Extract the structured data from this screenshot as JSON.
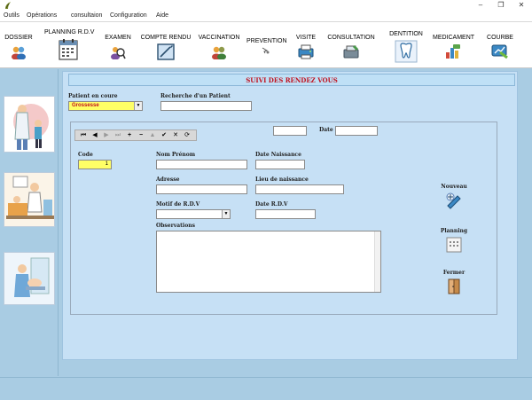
{
  "menubar": {
    "items": [
      "Outils",
      "Opérations",
      "consultaion",
      "Configuration",
      "Aide"
    ]
  },
  "window_controls": {
    "minimize": "‒",
    "restore": "❐",
    "close": "✕"
  },
  "toolbar": {
    "items": [
      {
        "label": "DOSSIER",
        "icon": "patients-icon"
      },
      {
        "label": "PLANNING R.D.V",
        "icon": "calendar-icon"
      },
      {
        "label": "EXAMEN",
        "icon": "examination-icon"
      },
      {
        "label": "COMPTE RENDU",
        "icon": "report-icon"
      },
      {
        "label": "VACCINATION",
        "icon": "vaccination-icon"
      },
      {
        "label": "PREVENTION",
        "icon": "prevention-icon"
      },
      {
        "label": "VISITE",
        "icon": "visit-icon"
      },
      {
        "label": "CONSULTATION",
        "icon": "consultation-icon"
      },
      {
        "label": "DENTITION",
        "icon": "tooth-icon"
      },
      {
        "label": "MEDICAMENT",
        "icon": "medicine-icon"
      },
      {
        "label": "COURBE",
        "icon": "chart-icon"
      }
    ]
  },
  "form": {
    "title": "SUIVI DES RENDEZ VOUS",
    "patient_en_cours_label": "Patient en  coure",
    "patient_en_cours_value": "Grossesse",
    "recherche_label": "Recherche d'un Patient",
    "recherche_value": "",
    "top_small_value": "",
    "date_label": "Date",
    "date_value": "",
    "code_label": "Code",
    "code_value": "1",
    "nom_label": "Nom  Prénom",
    "nom_value": "",
    "date_naissance_label": "Date Naissance",
    "date_naissance_value": "",
    "adresse_label": "Adresse",
    "adresse_value": "",
    "lieu_naissance_label": "Lieu de naissance",
    "lieu_naissance_value": "",
    "motif_label": "Motif de R.D.V",
    "motif_value": "",
    "date_rdv_label": "Date R.D.V",
    "date_rdv_value": "",
    "observations_label": "Observations",
    "observations_value": ""
  },
  "navigator": {
    "buttons": [
      "⏮",
      "◀",
      "▶",
      "⏭",
      "+",
      "−",
      "▲",
      "✔",
      "✕",
      "⟳"
    ]
  },
  "actions": {
    "nouveau": "Nouveau",
    "planning": "Planning",
    "fermer": "Fermer"
  },
  "colors": {
    "background": "#a9cce3",
    "form_bg": "#c6e0f5",
    "title_red": "#c1121f",
    "highlight_yellow": "#ffff66"
  }
}
